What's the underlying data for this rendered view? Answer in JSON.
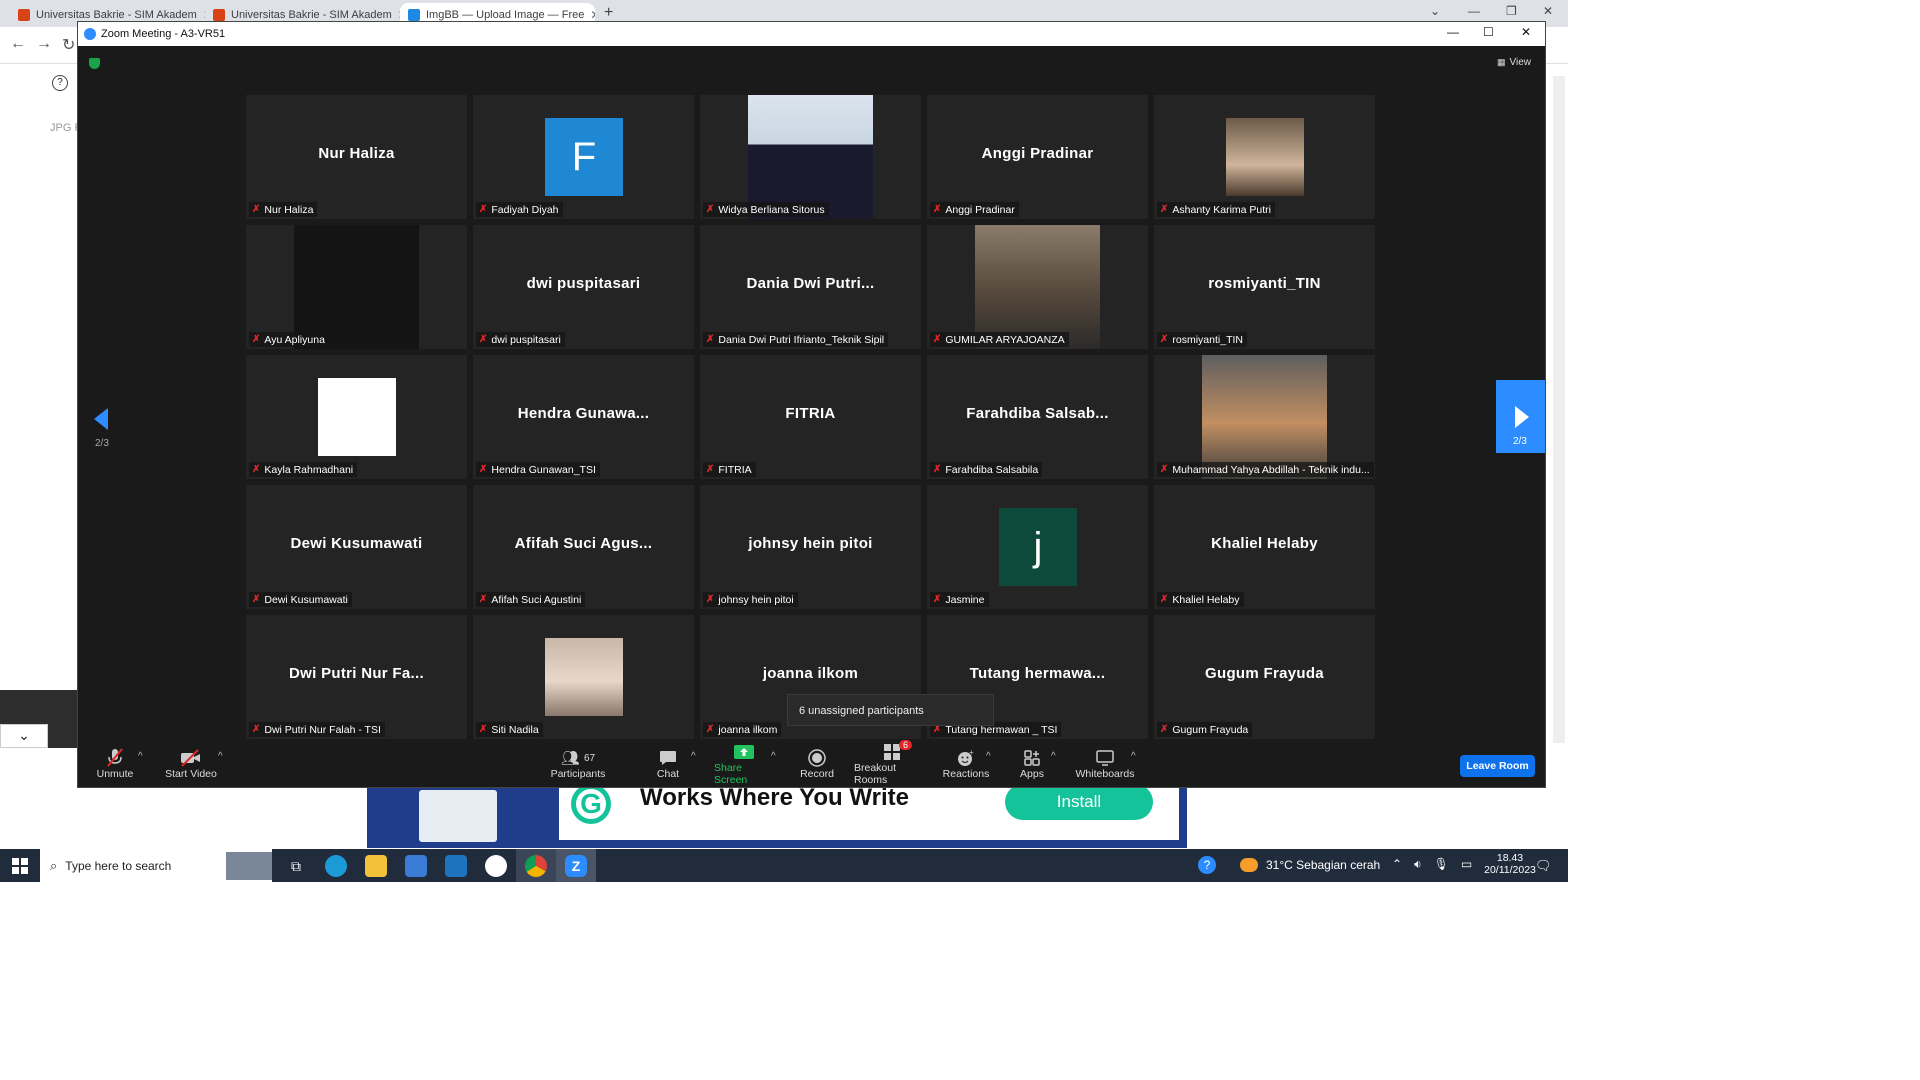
{
  "browser": {
    "tabs": [
      {
        "title": "Universitas Bakrie - SIM Akadem",
        "active": false
      },
      {
        "title": "Universitas Bakrie - SIM Akadem",
        "active": false
      },
      {
        "title": "ImgBB — Upload Image — Free",
        "active": true
      }
    ],
    "new_tab": "+",
    "page_snippet": "JPG P",
    "ad": {
      "headline": "Works Where You Write",
      "button": "Install"
    }
  },
  "zoom": {
    "window_title": "Zoom Meeting - A3-VR51",
    "view_label": "View",
    "page_indicator": "2/3",
    "tiles": [
      {
        "name": "Nur Haliza",
        "label": "Nur Haliza",
        "kind": "text"
      },
      {
        "name": "",
        "label": "Fadiyah Diyah",
        "kind": "avatar",
        "letter": "F",
        "color": "#1e88d4"
      },
      {
        "name": "",
        "label": "Widya Berliana Sitorus",
        "kind": "photo"
      },
      {
        "name": "Anggi Pradinar",
        "label": "Anggi Pradinar",
        "kind": "text"
      },
      {
        "name": "",
        "label": "Ashanty Karima Putri",
        "kind": "photo"
      },
      {
        "name": "",
        "label": "Ayu Apliyuna",
        "kind": "dark"
      },
      {
        "name": "dwi puspitasari",
        "label": "dwi puspitasari",
        "kind": "text"
      },
      {
        "name": "Dania Dwi Putri...",
        "label": "Dania Dwi Putri Ifrianto_Teknik Sipil",
        "kind": "text"
      },
      {
        "name": "",
        "label": "GUMILAR ARYAJOANZA",
        "kind": "photo"
      },
      {
        "name": "rosmiyanti_TIN",
        "label": "rosmiyanti_TIN",
        "kind": "text"
      },
      {
        "name": "",
        "label": "Kayla Rahmadhani",
        "kind": "card"
      },
      {
        "name": "Hendra Gunawa...",
        "label": "Hendra Gunawan_TSI",
        "kind": "text"
      },
      {
        "name": "FITRIA",
        "label": "FITRIA",
        "kind": "text"
      },
      {
        "name": "Farahdiba Salsab...",
        "label": "Farahdiba Salsabila",
        "kind": "text"
      },
      {
        "name": "",
        "label": "Muhammad Yahya Abdillah - Teknik indu...",
        "kind": "photo"
      },
      {
        "name": "Dewi Kusumawati",
        "label": "Dewi Kusumawati",
        "kind": "text"
      },
      {
        "name": "Afifah Suci Agus...",
        "label": "Afifah Suci Agustini",
        "kind": "text"
      },
      {
        "name": "johnsy hein pitoi",
        "label": "johnsy hein pitoi",
        "kind": "text"
      },
      {
        "name": "",
        "label": "Jasmine",
        "kind": "avatar",
        "letter": "j",
        "color": "#0d4a3c"
      },
      {
        "name": "Khaliel Helaby",
        "label": "Khaliel Helaby",
        "kind": "text"
      },
      {
        "name": "Dwi Putri Nur Fa...",
        "label": "Dwi Putri Nur Falah - TSI",
        "kind": "text"
      },
      {
        "name": "",
        "label": "Siti Nadila",
        "kind": "photo"
      },
      {
        "name": "joanna ilkom",
        "label": "joanna ilkom",
        "kind": "text"
      },
      {
        "name": "Tutang hermawa...",
        "label": "Tutang hermawan _ TSI",
        "kind": "text"
      },
      {
        "name": "Gugum Frayuda",
        "label": "Gugum Frayuda",
        "kind": "text"
      }
    ],
    "tooltip": "6 unassigned participants",
    "toolbar": {
      "unmute": "Unmute",
      "start_video": "Start Video",
      "participants": "Participants",
      "participants_count": "67",
      "chat": "Chat",
      "share_screen": "Share Screen",
      "record": "Record",
      "breakout_rooms": "Breakout Rooms",
      "breakout_badge": "6",
      "reactions": "Reactions",
      "apps": "Apps",
      "whiteboards": "Whiteboards",
      "leave": "Leave Room"
    }
  },
  "taskbar": {
    "search_placeholder": "Type here to search",
    "weather": "31°C  Sebagian cerah",
    "time": "18.43",
    "date": "20/11/2023"
  }
}
